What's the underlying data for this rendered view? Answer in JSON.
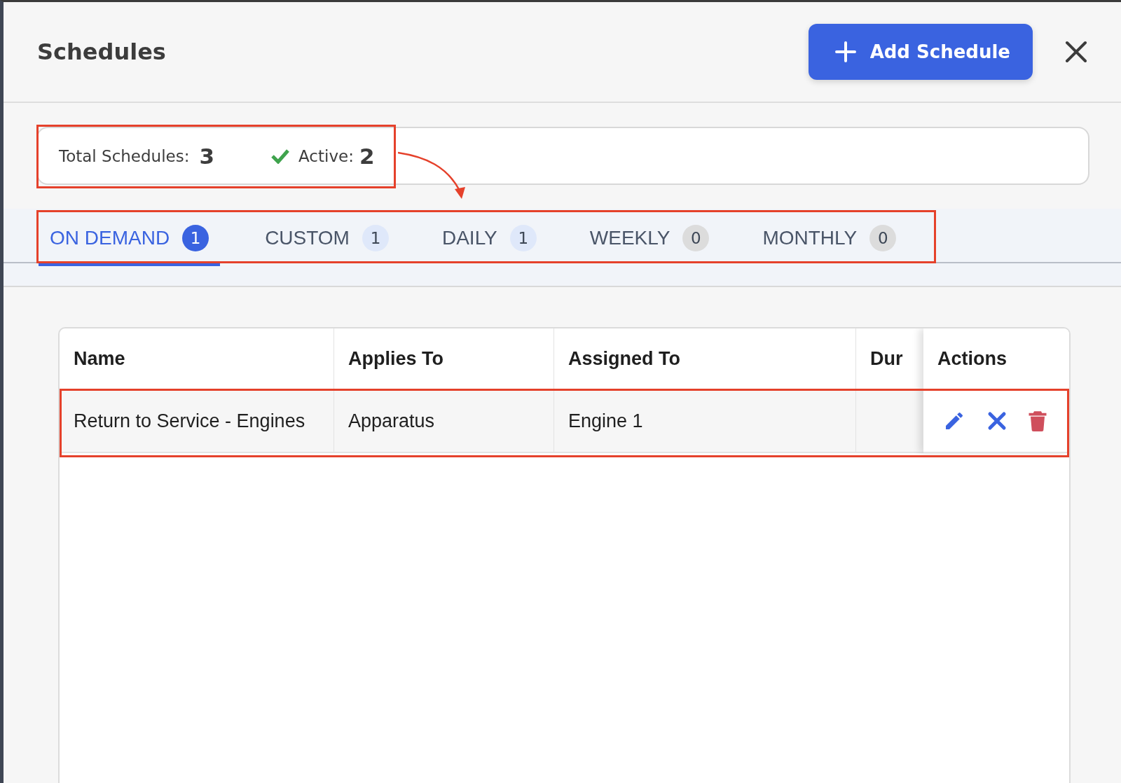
{
  "header": {
    "title": "Schedules",
    "add_button": "Add Schedule"
  },
  "stats": {
    "highlighted": true,
    "total_label": "Total Schedules:",
    "total_value": "3",
    "active_label": "Active:",
    "active_value": "2"
  },
  "tabs_highlighted": true,
  "tabs": [
    {
      "label": "ON DEMAND",
      "count": "1",
      "selected": true,
      "color": "#3a63e0"
    },
    {
      "label": "CUSTOM",
      "count": "1",
      "selected": false,
      "color": "#dfe8fa"
    },
    {
      "label": "DAILY",
      "count": "1",
      "selected": false,
      "color": "#dfe8fa"
    },
    {
      "label": "WEEKLY",
      "count": "0",
      "selected": false,
      "color": "#dcdcdc"
    },
    {
      "label": "MONTHLY",
      "count": "0",
      "selected": false,
      "color": "#dcdcdc"
    }
  ],
  "table": {
    "columns": [
      "Name",
      "Applies To",
      "Assigned To",
      "Dur",
      "Actions"
    ],
    "rows": [
      {
        "highlighted": true,
        "cells": [
          "Return to Service - Engines",
          "Apparatus",
          "Engine 1",
          ""
        ],
        "actions": [
          {
            "kind": "edit"
          },
          {
            "kind": "cancel"
          },
          {
            "kind": "delete"
          }
        ]
      }
    ]
  }
}
